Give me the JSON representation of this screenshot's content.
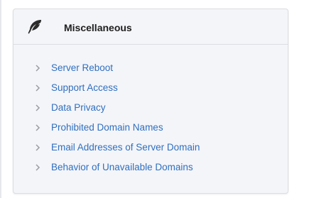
{
  "panel": {
    "title": "Miscellaneous",
    "icon": "feather-icon",
    "items": [
      {
        "label": "Server Reboot",
        "icon": "chevron-right-icon"
      },
      {
        "label": "Support Access",
        "icon": "chevron-right-icon"
      },
      {
        "label": "Data Privacy",
        "icon": "chevron-right-icon"
      },
      {
        "label": "Prohibited Domain Names",
        "icon": "chevron-right-icon"
      },
      {
        "label": "Email Addresses of Server Domain",
        "icon": "chevron-right-icon"
      },
      {
        "label": "Behavior of Unavailable Domains",
        "icon": "chevron-right-icon"
      }
    ]
  },
  "colors": {
    "link": "#2f6fbf",
    "panel_background": "#f4f5f9",
    "border": "#dcdde3",
    "chevron": "#9a9ca3"
  }
}
